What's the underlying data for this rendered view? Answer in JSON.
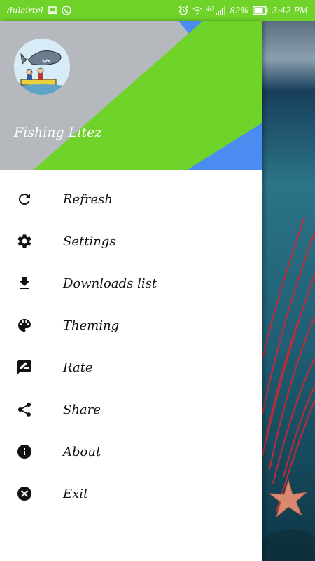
{
  "status_bar": {
    "carrier": "dulairtel",
    "battery_percent": "82%",
    "time": "3:42 PM",
    "network_label": "4G",
    "color": "#6fd32a"
  },
  "drawer": {
    "app_title": "Fishing Litez",
    "header_colors": {
      "gray": "#b5b8bd",
      "green": "#6fd32a",
      "blue": "#4a8cf0"
    },
    "menu": [
      {
        "label": "Refresh",
        "icon": "refresh-icon"
      },
      {
        "label": "Settings",
        "icon": "gear-icon"
      },
      {
        "label": "Downloads list",
        "icon": "download-icon"
      },
      {
        "label": "Theming",
        "icon": "palette-icon"
      },
      {
        "label": "Rate",
        "icon": "rate-icon"
      },
      {
        "label": "Share",
        "icon": "share-icon"
      },
      {
        "label": "About",
        "icon": "info-icon"
      },
      {
        "label": "Exit",
        "icon": "close-circle-icon"
      }
    ]
  }
}
